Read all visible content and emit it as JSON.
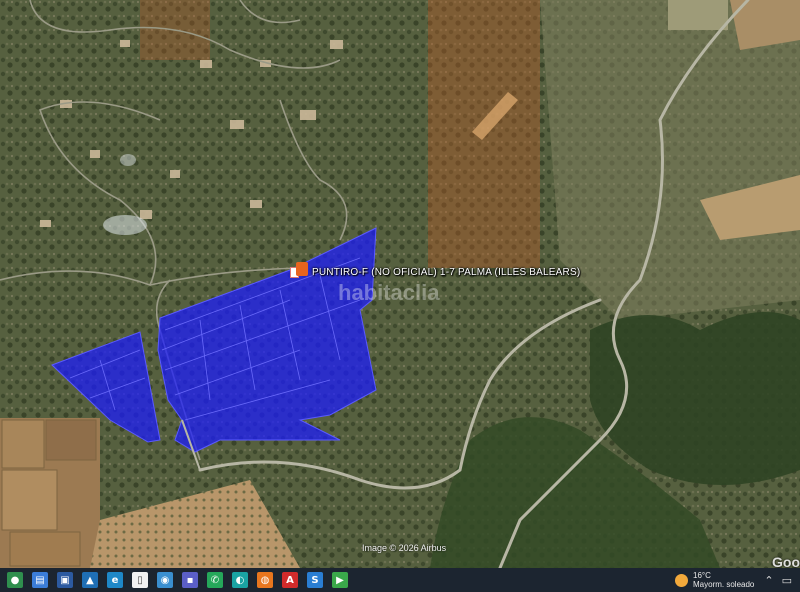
{
  "map": {
    "place_label": "PUNTIRO-F (NO OFICIAL) 1-7  PALMA (ILLES BALEARS)",
    "watermark": "habitaclia",
    "imagery_credit": "Image © 2026 Airbus",
    "logo": "Google",
    "overlay_color": "#1a1aff",
    "highlight_color": "#b45a28"
  },
  "taskbar": {
    "icons": [
      {
        "name": "chrome-icon",
        "glyph": "●",
        "color": "#2f8f4e"
      },
      {
        "name": "file-explorer-icon",
        "glyph": "▤",
        "color": "#3b7dd8"
      },
      {
        "name": "photos-icon",
        "glyph": "▣",
        "color": "#2c5aa0"
      },
      {
        "name": "image-viewer-icon",
        "glyph": "▲",
        "color": "#1f6fb5"
      },
      {
        "name": "edge-icon",
        "glyph": "e",
        "color": "#1e88c8"
      },
      {
        "name": "document-icon",
        "glyph": "▯",
        "color": "#f2f2f2"
      },
      {
        "name": "media-icon",
        "glyph": "◉",
        "color": "#3a8fd0"
      },
      {
        "name": "save-icon",
        "glyph": "▪",
        "color": "#5b5fc7"
      },
      {
        "name": "whatsapp-icon",
        "glyph": "✆",
        "color": "#25a85a"
      },
      {
        "name": "webex-icon",
        "glyph": "◐",
        "color": "#1aa3a3"
      },
      {
        "name": "firefox-icon",
        "glyph": "◍",
        "color": "#e8761e"
      },
      {
        "name": "acrobat-icon",
        "glyph": "A",
        "color": "#d22b2b"
      },
      {
        "name": "app-s-icon",
        "glyph": "S",
        "color": "#2a7ed3"
      },
      {
        "name": "app-green-icon",
        "glyph": "▶",
        "color": "#3aa84a"
      }
    ],
    "weather": {
      "temperature": "16°C",
      "condition": "Mayorm. soleado"
    }
  }
}
